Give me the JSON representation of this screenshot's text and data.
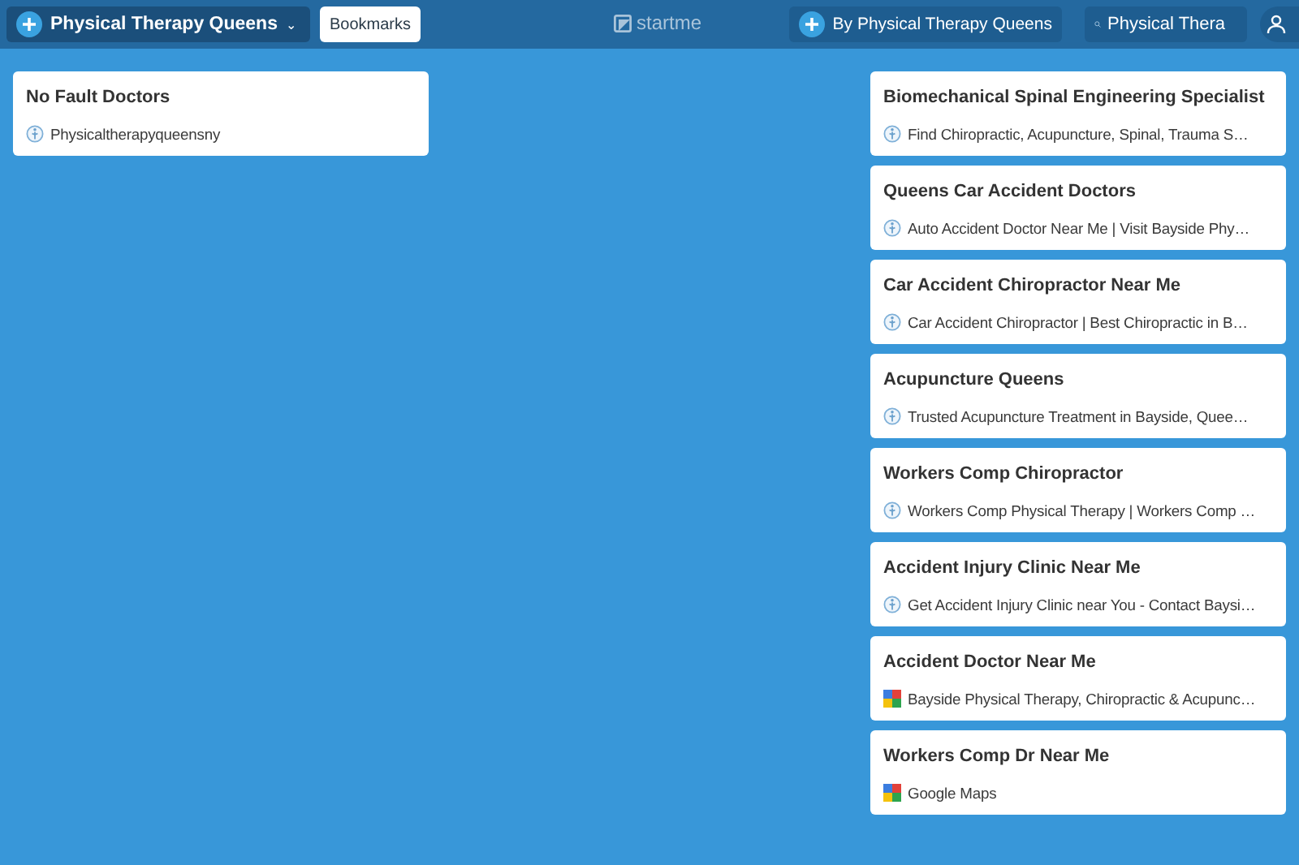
{
  "topbar": {
    "page_menu": {
      "label": "Physical Therapy Queens",
      "caret": "⌄"
    },
    "bookmarks_button": "Bookmarks",
    "logo": "startme",
    "author_button": "By Physical Therapy Queens",
    "search": {
      "value": "Physical Thera"
    }
  },
  "columns": [
    {
      "widgets": [
        {
          "title": "No Fault Doctors",
          "links": [
            {
              "text": "Physicaltherapyqueensny",
              "kind": "site"
            }
          ]
        }
      ]
    },
    {
      "widgets": [
        {
          "title": "Biomechanical Spinal Engineering Specialist",
          "links": [
            {
              "text": "Find Chiropractic, Acupuncture, Spinal, Trauma S…",
              "kind": "site"
            }
          ]
        },
        {
          "title": "Queens Car Accident Doctors",
          "links": [
            {
              "text": "Auto Accident Doctor Near Me | Visit Bayside Phy…",
              "kind": "site"
            }
          ]
        },
        {
          "title": "Car Accident Chiropractor Near Me",
          "links": [
            {
              "text": "Car Accident Chiropractor | Best Chiropractic in B…",
              "kind": "site"
            }
          ]
        },
        {
          "title": "Acupuncture Queens",
          "links": [
            {
              "text": "Trusted Acupuncture Treatment in Bayside, Quee…",
              "kind": "site"
            }
          ]
        },
        {
          "title": "Workers Comp Chiropractor",
          "links": [
            {
              "text": "Workers Comp Physical Therapy | Workers Comp …",
              "kind": "site"
            }
          ]
        },
        {
          "title": "Accident Injury Clinic Near Me",
          "links": [
            {
              "text": "Get Accident Injury Clinic near You - Contact Baysi…",
              "kind": "site"
            }
          ]
        },
        {
          "title": "Accident Doctor Near Me",
          "links": [
            {
              "text": "Bayside Physical Therapy, Chiropractic & Acupunc…",
              "kind": "maps"
            }
          ]
        },
        {
          "title": "Workers Comp Dr Near Me",
          "links": [
            {
              "text": "Google Maps",
              "kind": "maps"
            }
          ]
        }
      ]
    }
  ]
}
